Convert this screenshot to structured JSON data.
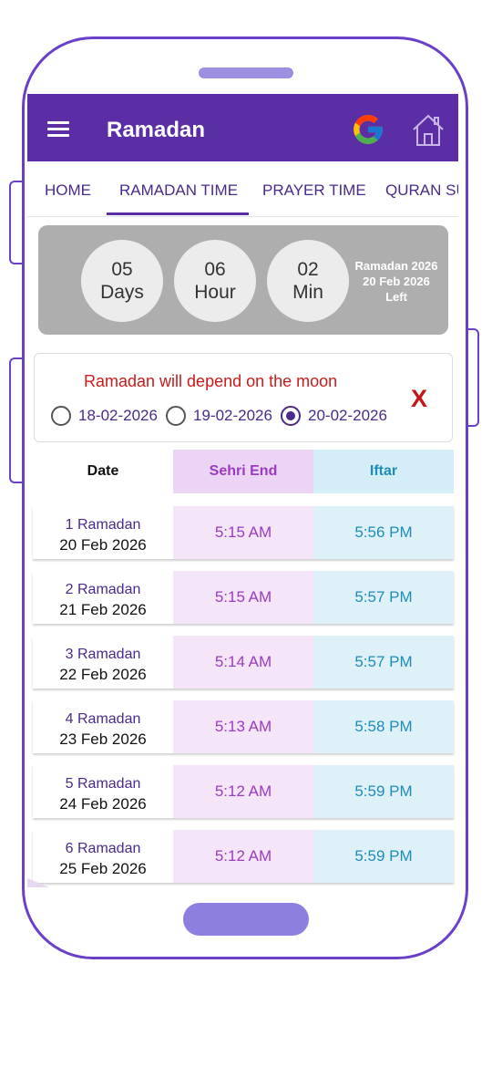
{
  "appbar": {
    "title": "Ramadan"
  },
  "tabs": [
    {
      "label": "HOME"
    },
    {
      "label": "RAMADAN TIME",
      "active": true
    },
    {
      "label": "PRAYER TIME"
    },
    {
      "label": "QURAN SU"
    }
  ],
  "countdown": {
    "days": {
      "value": "05",
      "unit": "Days"
    },
    "hours": {
      "value": "06",
      "unit": "Hour"
    },
    "minutes": {
      "value": "02",
      "unit": "Min"
    },
    "info_line1": "Ramadan 2026",
    "info_line2": "20 Feb 2026",
    "info_line3": "Left"
  },
  "moon": {
    "message": "Ramadan will depend on the moon",
    "options": [
      "18-02-2026",
      "19-02-2026",
      "20-02-2026"
    ],
    "selected": "20-02-2026",
    "close_label": "X"
  },
  "table": {
    "headers": {
      "date": "Date",
      "sehri": "Sehri End",
      "iftar": "Iftar"
    },
    "rows": [
      {
        "ramadan": "1 Ramadan",
        "date": "20 Feb 2026",
        "sehri": "5:15 AM",
        "iftar": "5:56 PM"
      },
      {
        "ramadan": "2 Ramadan",
        "date": "21 Feb 2026",
        "sehri": "5:15 AM",
        "iftar": "5:57 PM"
      },
      {
        "ramadan": "3 Ramadan",
        "date": "22 Feb 2026",
        "sehri": "5:14 AM",
        "iftar": "5:57 PM"
      },
      {
        "ramadan": "4 Ramadan",
        "date": "23 Feb 2026",
        "sehri": "5:13 AM",
        "iftar": "5:58 PM"
      },
      {
        "ramadan": "5 Ramadan",
        "date": "24 Feb 2026",
        "sehri": "5:12 AM",
        "iftar": "5:59 PM"
      },
      {
        "ramadan": "6 Ramadan",
        "date": "25 Feb 2026",
        "sehri": "5:12 AM",
        "iftar": "5:59 PM"
      }
    ]
  },
  "colors": {
    "primary": "#5b2ea6",
    "frame": "#6a40c8",
    "sehri": "#9a3cc0",
    "iftar": "#1f8cb5",
    "alert": "#cc1b1b"
  }
}
